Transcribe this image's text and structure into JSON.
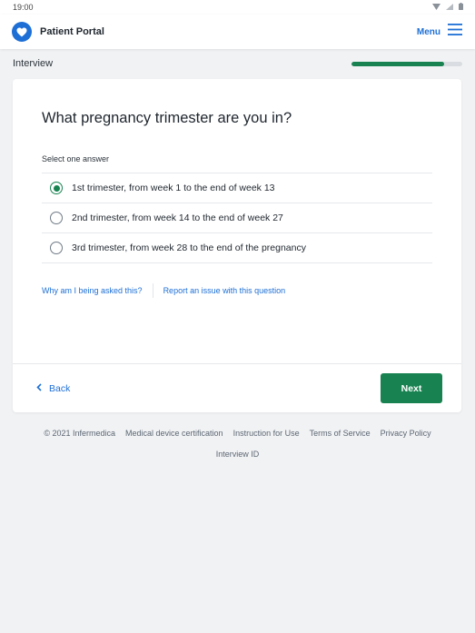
{
  "status_bar": {
    "time": "19:00",
    "icons": [
      "wifi-icon",
      "signal-icon",
      "battery-icon"
    ]
  },
  "header": {
    "title": "Patient Portal",
    "logo_icon": "heart-icon",
    "menu_label": "Menu",
    "menu_icon": "hamburger-icon",
    "brand_color": "#1d6fd6"
  },
  "progress": {
    "label": "Interview",
    "fraction": 0.84,
    "color": "#188351"
  },
  "question": {
    "title": "What pregnancy trimester are you in?",
    "instruction": "Select one answer",
    "answers": [
      {
        "label": "1st trimester, from week 1 to the end of week 13",
        "selected": true
      },
      {
        "label": "2nd trimester, from week 14 to the end of week 27",
        "selected": false
      },
      {
        "label": "3rd trimester, from week 28 to the end of the pregnancy",
        "selected": false
      }
    ],
    "why_link": "Why am I being asked this?",
    "report_link": "Report an issue with this question"
  },
  "navigation": {
    "back_label": "Back",
    "back_icon": "chevron-left-icon",
    "next_label": "Next",
    "accent_color": "#188351"
  },
  "footer": {
    "copyright": "© 2021 Infermedica",
    "links": [
      "Medical device certification",
      "Instruction for Use",
      "Terms of Service",
      "Privacy Policy"
    ],
    "interview_id": "Interview ID"
  }
}
